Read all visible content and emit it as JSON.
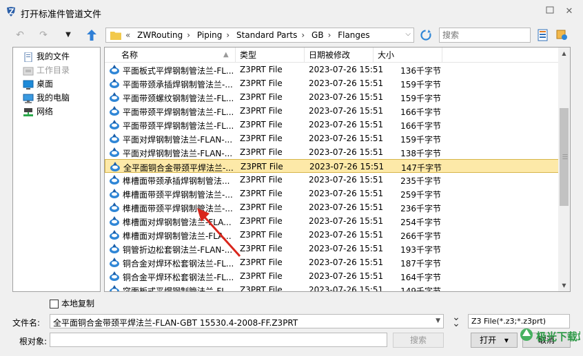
{
  "window": {
    "title": "打开标准件管道文件",
    "help_glyph": "?",
    "close_glyph": "✕"
  },
  "nav": {
    "back_glyph": "↶",
    "forward_glyph": "↷",
    "dropdown_glyph": "▼",
    "up_glyph": "⬆"
  },
  "breadcrumb": {
    "prefix": "«",
    "items": [
      "ZWRouting",
      "Piping",
      "Standard Parts",
      "GB",
      "Flanges"
    ],
    "separator": "›"
  },
  "search": {
    "placeholder": "搜索"
  },
  "sidebar": {
    "items": [
      {
        "label": "我的文件",
        "icon": "my-files-icon",
        "enabled": true
      },
      {
        "label": "工作目录",
        "icon": "working-directory-icon",
        "enabled": false
      },
      {
        "label": "桌面",
        "icon": "desktop-icon",
        "enabled": true
      },
      {
        "label": "我的电脑",
        "icon": "computer-icon",
        "enabled": true
      },
      {
        "label": "网络",
        "icon": "network-icon",
        "enabled": true
      }
    ]
  },
  "list": {
    "columns": [
      "名称",
      "类型",
      "日期被修改",
      "大小"
    ],
    "sort_glyph": "▲",
    "rows": [
      {
        "name": "平面板式平焊钢制管法兰-FL...",
        "type": "Z3PRT File",
        "date": "2023-07-26 15:51",
        "size": "136千字节",
        "selected": false
      },
      {
        "name": "平面带颈承插焊钢制管法兰-...",
        "type": "Z3PRT File",
        "date": "2023-07-26 15:51",
        "size": "159千字节",
        "selected": false
      },
      {
        "name": "平面带颈螺纹钢制管法兰-FL...",
        "type": "Z3PRT File",
        "date": "2023-07-26 15:51",
        "size": "159千字节",
        "selected": false
      },
      {
        "name": "平面带颈平焊钢制管法兰-FL...",
        "type": "Z3PRT File",
        "date": "2023-07-26 15:51",
        "size": "166千字节",
        "selected": false
      },
      {
        "name": "平面带颈平焊钢制管法兰-FL...",
        "type": "Z3PRT File",
        "date": "2023-07-26 15:51",
        "size": "166千字节",
        "selected": false
      },
      {
        "name": "平面对焊钢制管法兰-FLAN-...",
        "type": "Z3PRT File",
        "date": "2023-07-26 15:51",
        "size": "159千字节",
        "selected": false
      },
      {
        "name": "平面对焊钢制管法兰-FLAN-...",
        "type": "Z3PRT File",
        "date": "2023-07-26 15:51",
        "size": "138千字节",
        "selected": false
      },
      {
        "name": "全平面铜合金带颈平焊法兰-...",
        "type": "Z3PRT File",
        "date": "2023-07-26 15:51",
        "size": "147千字节",
        "selected": true
      },
      {
        "name": "榫槽面带颈承插焊钢制管法...",
        "type": "Z3PRT File",
        "date": "2023-07-26 15:51",
        "size": "235千字节",
        "selected": false
      },
      {
        "name": "榫槽面带颈平焊钢制管法兰-...",
        "type": "Z3PRT File",
        "date": "2023-07-26 15:51",
        "size": "259千字节",
        "selected": false
      },
      {
        "name": "榫槽面带颈平焊钢制管法兰-...",
        "type": "Z3PRT File",
        "date": "2023-07-26 15:51",
        "size": "236千字节",
        "selected": false
      },
      {
        "name": "榫槽面对焊钢制管法兰-FLA...",
        "type": "Z3PRT File",
        "date": "2023-07-26 15:51",
        "size": "254千字节",
        "selected": false
      },
      {
        "name": "榫槽面对焊钢制管法兰-FLA...",
        "type": "Z3PRT File",
        "date": "2023-07-26 15:51",
        "size": "266千字节",
        "selected": false
      },
      {
        "name": "铜管折边松套钢法兰-FLAN-...",
        "type": "Z3PRT File",
        "date": "2023-07-26 15:51",
        "size": "193千字节",
        "selected": false
      },
      {
        "name": "铜合金对焊环松套钢法兰-FL...",
        "type": "Z3PRT File",
        "date": "2023-07-26 15:51",
        "size": "187千字节",
        "selected": false
      },
      {
        "name": "铜合金平焊环松套钢法兰-FL...",
        "type": "Z3PRT File",
        "date": "2023-07-26 15:51",
        "size": "164千字节",
        "selected": false
      },
      {
        "name": "突面板式平焊钢制管法兰-FL...",
        "type": "Z3PRT File",
        "date": "2023-07-26 15:51",
        "size": "149千字节",
        "selected": false
      }
    ]
  },
  "options": {
    "local_copy_label": "本地复制",
    "local_copy_checked": false
  },
  "filename": {
    "label": "文件名:",
    "value": "全平面铜合金带颈平焊法兰-FLAN-GBT 15530.4-2008-FF.Z3PRT"
  },
  "filetype": {
    "value": "Z3 File(*.z3;*.z3prt)"
  },
  "root": {
    "label": "根对象:",
    "value": ""
  },
  "buttons": {
    "search_label": "搜索",
    "open_label": "打开",
    "open_dropdown_glyph": "▾",
    "cancel_label": "取消"
  },
  "watermark": {
    "text": "极光下载站"
  },
  "colors": {
    "selection_bg": "#fde9a8",
    "annotation_arrow": "#d9261c"
  }
}
